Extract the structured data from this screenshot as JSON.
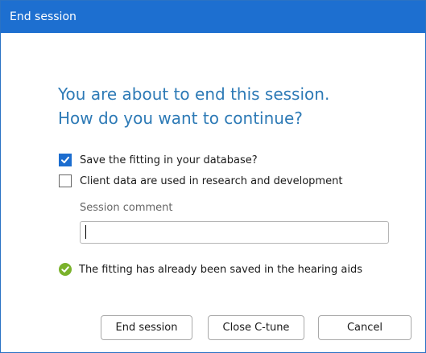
{
  "window": {
    "title": "End session"
  },
  "heading": {
    "line1": "You are about to end this session.",
    "line2": "How do you want to continue?"
  },
  "options": [
    {
      "label": "Save the fitting in your database?",
      "checked": true
    },
    {
      "label": "Client data are used in research and development",
      "checked": false
    }
  ],
  "comment": {
    "label": "Session comment",
    "value": ""
  },
  "status": {
    "text": "The fitting has already been saved in the hearing aids",
    "icon": "check-circle-icon"
  },
  "buttons": {
    "end_session": "End session",
    "close_ctune": "Close C-tune",
    "cancel": "Cancel"
  },
  "colors": {
    "titlebar": "#1d6fd0",
    "heading": "#2d7ab6",
    "checkbox_accent": "#1c6dcf",
    "success": "#7ab22b"
  }
}
